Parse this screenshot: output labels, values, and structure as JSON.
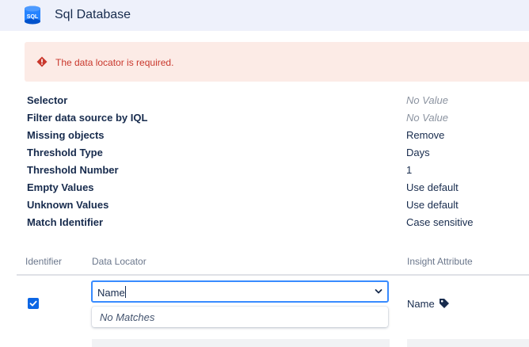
{
  "header": {
    "title": "Sql Database",
    "icon": "sql-database-icon"
  },
  "error": {
    "message": "The data locator is required.",
    "icon": "error-icon",
    "color": "#c9372c"
  },
  "properties": [
    {
      "label": "Selector",
      "value": "No Value",
      "muted": true
    },
    {
      "label": "Filter data source by IQL",
      "value": "No Value",
      "muted": true
    },
    {
      "label": "Missing objects",
      "value": "Remove",
      "muted": false
    },
    {
      "label": "Threshold Type",
      "value": "Days",
      "muted": false
    },
    {
      "label": "Threshold Number",
      "value": "1",
      "muted": false
    },
    {
      "label": "Empty Values",
      "value": "Use default",
      "muted": false
    },
    {
      "label": "Unknown Values",
      "value": "Use default",
      "muted": false
    },
    {
      "label": "Match Identifier",
      "value": "Case sensitive",
      "muted": false
    }
  ],
  "table": {
    "columns": {
      "identifier": "Identifier",
      "data_locator": "Data Locator",
      "insight_attribute": "Insight Attribute"
    },
    "row": {
      "identifier_checked": true,
      "data_locator_value": "Name",
      "insight_attribute": "Name"
    }
  },
  "dropdown": {
    "no_matches": "No Matches"
  },
  "colors": {
    "accent": "#0c66e4",
    "focus_border": "#388bff",
    "header_bg": "#eef1fb",
    "error_bg": "#fcebe6"
  }
}
